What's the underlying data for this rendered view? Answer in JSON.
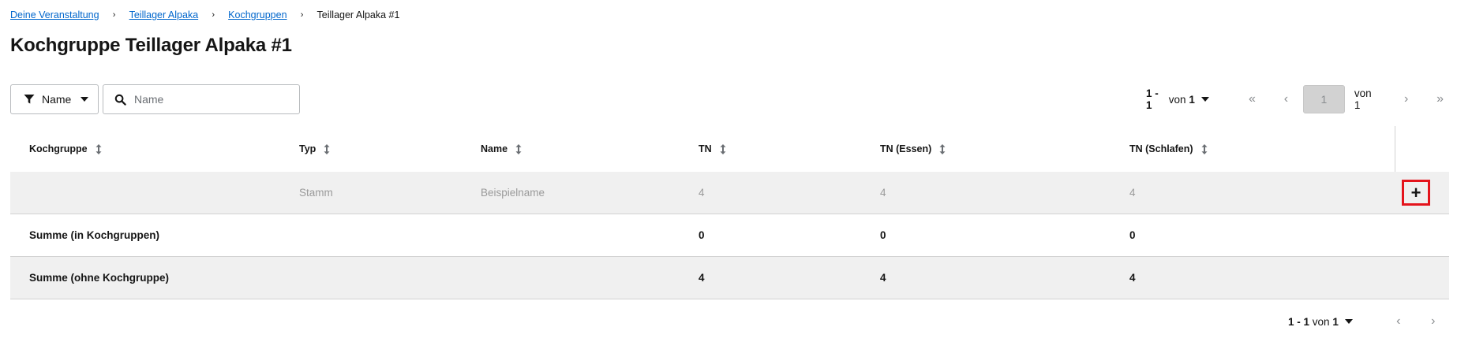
{
  "breadcrumb": {
    "items": [
      "Deine Veranstaltung",
      "Teillager Alpaka",
      "Kochgruppen"
    ],
    "current": "Teillager Alpaka #1",
    "separator": "›"
  },
  "page": {
    "title": "Kochgruppe Teillager Alpaka #1"
  },
  "toolbar": {
    "filter_label": "Name",
    "search_placeholder": "Name",
    "search_value": ""
  },
  "pagination": {
    "range": "1 - 1",
    "of_word": "von",
    "total": "1",
    "current_page": "1",
    "page_of": "von 1",
    "first": "«",
    "prev": "‹",
    "next": "›",
    "last": "»"
  },
  "table": {
    "columns": [
      "Kochgruppe",
      "Typ",
      "Name",
      "TN",
      "TN (Essen)",
      "TN (Schlafen)"
    ],
    "example_row": [
      "",
      "Stamm",
      "Beispielname",
      "4",
      "4",
      "4"
    ],
    "sum_rows": [
      [
        "Summe (in Kochgruppen)",
        "",
        "",
        "0",
        "0",
        "0"
      ],
      [
        "Summe (ohne Kochgruppe)",
        "",
        "",
        "4",
        "4",
        "4"
      ]
    ],
    "add_label": "+"
  },
  "colors": {
    "link": "#0066cc",
    "highlight": "#e4141c",
    "row_alt": "#f0f0f0"
  }
}
